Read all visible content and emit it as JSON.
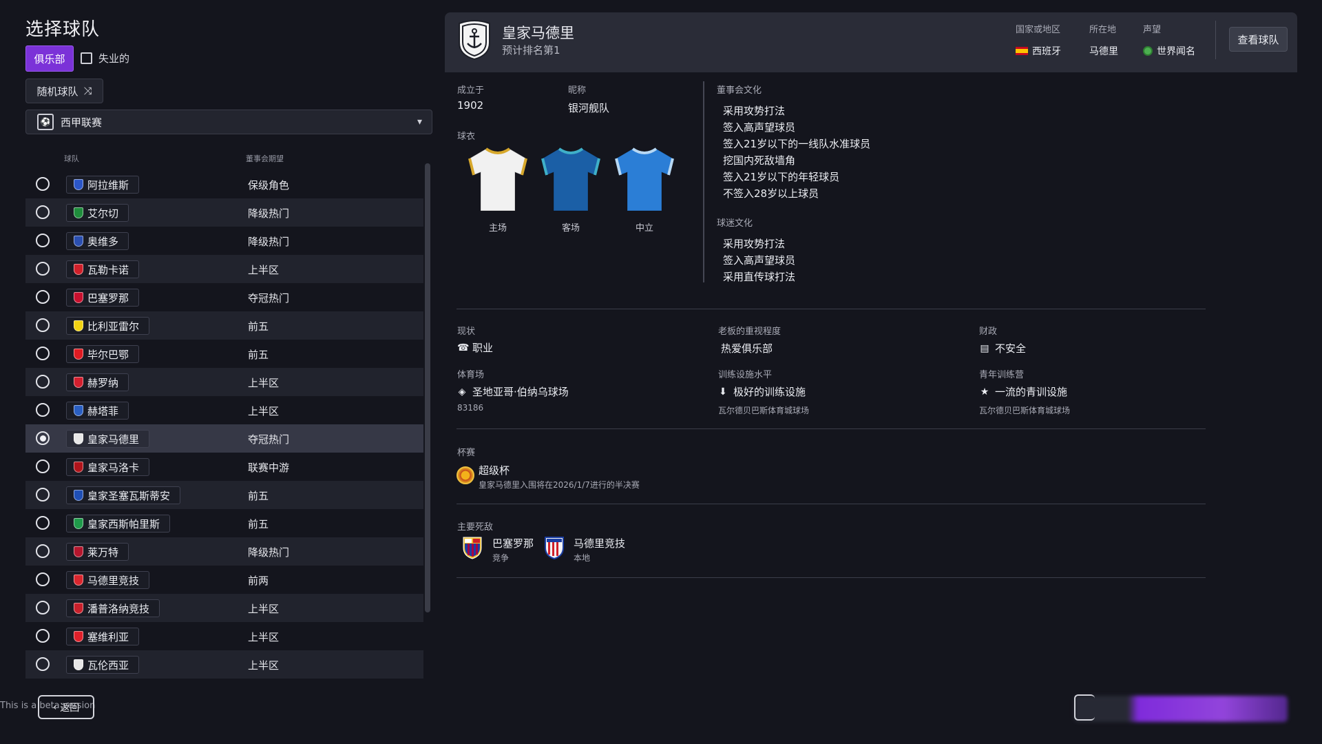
{
  "page": {
    "title": "选择球队",
    "club_tab": "俱乐部",
    "unemployed_label": "失业的",
    "random_team": "随机球队",
    "league": "西甲联赛",
    "col_team": "球队",
    "col_expectation": "董事会期望",
    "footer_note": "This is a beta version",
    "back": "返回"
  },
  "teams": [
    {
      "name": "阿拉维斯",
      "expectation": "保级角色",
      "color": "#2b56c7",
      "selected": false
    },
    {
      "name": "艾尔切",
      "expectation": "降级热门",
      "color": "#1f8d3c",
      "selected": false
    },
    {
      "name": "奥维多",
      "expectation": "降级热门",
      "color": "#2b4fb0",
      "selected": false
    },
    {
      "name": "瓦勒卡诺",
      "expectation": "上半区",
      "color": "#d0202a",
      "selected": false
    },
    {
      "name": "巴塞罗那",
      "expectation": "夺冠热门",
      "color": "#c8102e",
      "selected": false
    },
    {
      "name": "比利亚雷尔",
      "expectation": "前五",
      "color": "#f2d312",
      "selected": false
    },
    {
      "name": "毕尔巴鄂",
      "expectation": "前五",
      "color": "#e01b22",
      "selected": false
    },
    {
      "name": "赫罗纳",
      "expectation": "上半区",
      "color": "#d21f2e",
      "selected": false
    },
    {
      "name": "赫塔菲",
      "expectation": "上半区",
      "color": "#2a5fc2",
      "selected": false
    },
    {
      "name": "皇家马德里",
      "expectation": "夺冠热门",
      "color": "#e8e8e8",
      "selected": true
    },
    {
      "name": "皇家马洛卡",
      "expectation": "联赛中游",
      "color": "#b0141b",
      "selected": false
    },
    {
      "name": "皇家圣塞瓦斯蒂安",
      "expectation": "前五",
      "color": "#1f4fb5",
      "selected": false
    },
    {
      "name": "皇家西斯帕里斯",
      "expectation": "前五",
      "color": "#1f9a4a",
      "selected": false
    },
    {
      "name": "莱万特",
      "expectation": "降级热门",
      "color": "#b4162d",
      "selected": false
    },
    {
      "name": "马德里竞技",
      "expectation": "前两",
      "color": "#d9262e",
      "selected": false
    },
    {
      "name": "潘普洛纳竞技",
      "expectation": "上半区",
      "color": "#c8202b",
      "selected": false
    },
    {
      "name": "塞维利亚",
      "expectation": "上半区",
      "color": "#e0202a",
      "selected": false
    },
    {
      "name": "瓦伦西亚",
      "expectation": "上半区",
      "color": "#e6e6e6",
      "selected": false
    }
  ],
  "club": {
    "name": "皇家马德里",
    "rank": "预计排名第1",
    "country_label": "国家或地区",
    "country": "西班牙",
    "location_label": "所在地",
    "location": "马德里",
    "reputation_label": "声望",
    "reputation": "世界闻名",
    "view_button": "查看球队",
    "founded_label": "成立于",
    "founded": "1902",
    "nickname_label": "昵称",
    "nickname": "银河舰队",
    "kits_label": "球衣",
    "kits": [
      {
        "label": "主场",
        "body": "#f1f1f1",
        "trim": "#d7a82c"
      },
      {
        "label": "客场",
        "body": "#1b5fa6",
        "trim": "#3fb0c8"
      },
      {
        "label": "中立",
        "body": "#2b7ed6",
        "trim": "#b7d8f4"
      }
    ],
    "board_culture_label": "董事会文化",
    "board_culture": [
      "采用攻势打法",
      "签入高声望球员",
      "签入21岁以下的一线队水准球员",
      "挖国内死敌墙角",
      "签入21岁以下的年轻球员",
      "不签入28岁以上球员"
    ],
    "fan_culture_label": "球迷文化",
    "fan_culture": [
      "采用攻势打法",
      "签入高声望球员",
      "采用直传球打法"
    ],
    "status_label": "现状",
    "status": "职业",
    "owner_label": "老板的重视程度",
    "owner": "热爱俱乐部",
    "finance_label": "财政",
    "finance": "不安全",
    "stadium_label": "体育场",
    "stadium": "圣地亚哥·伯纳乌球场",
    "capacity": "83186",
    "training_label": "训练设施水平",
    "training": "极好的训练设施",
    "training_sub": "瓦尔德贝巴斯体育城球场",
    "youth_label": "青年训练营",
    "youth": "一流的青训设施",
    "youth_sub": "瓦尔德贝巴斯体育城球场",
    "cups_label": "杯赛",
    "cup_name": "超级杯",
    "cup_desc": "皇家马德里入围将在2026/1/7进行的半决赛",
    "rivals_label": "主要死敌",
    "rivals": [
      {
        "name": "巴塞罗那",
        "type": "竞争"
      },
      {
        "name": "马德里竞技",
        "type": "本地"
      }
    ]
  }
}
